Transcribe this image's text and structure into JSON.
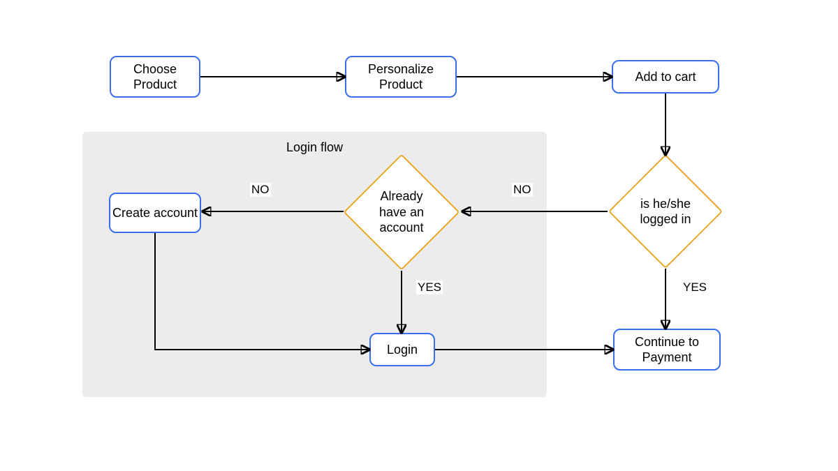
{
  "nodes": {
    "choose_product": "Choose Product",
    "personalize_product": "Personalize Product",
    "add_to_cart": "Add to cart",
    "logged_in": "is he/she logged in",
    "already_account": "Already have an account",
    "create_account": "Create account",
    "login": "Login",
    "continue_payment": "Continue to Payment"
  },
  "subgraph": {
    "title": "Login flow"
  },
  "edges": {
    "no1": "NO",
    "no2": "NO",
    "yes1": "YES",
    "yes2": "YES"
  }
}
